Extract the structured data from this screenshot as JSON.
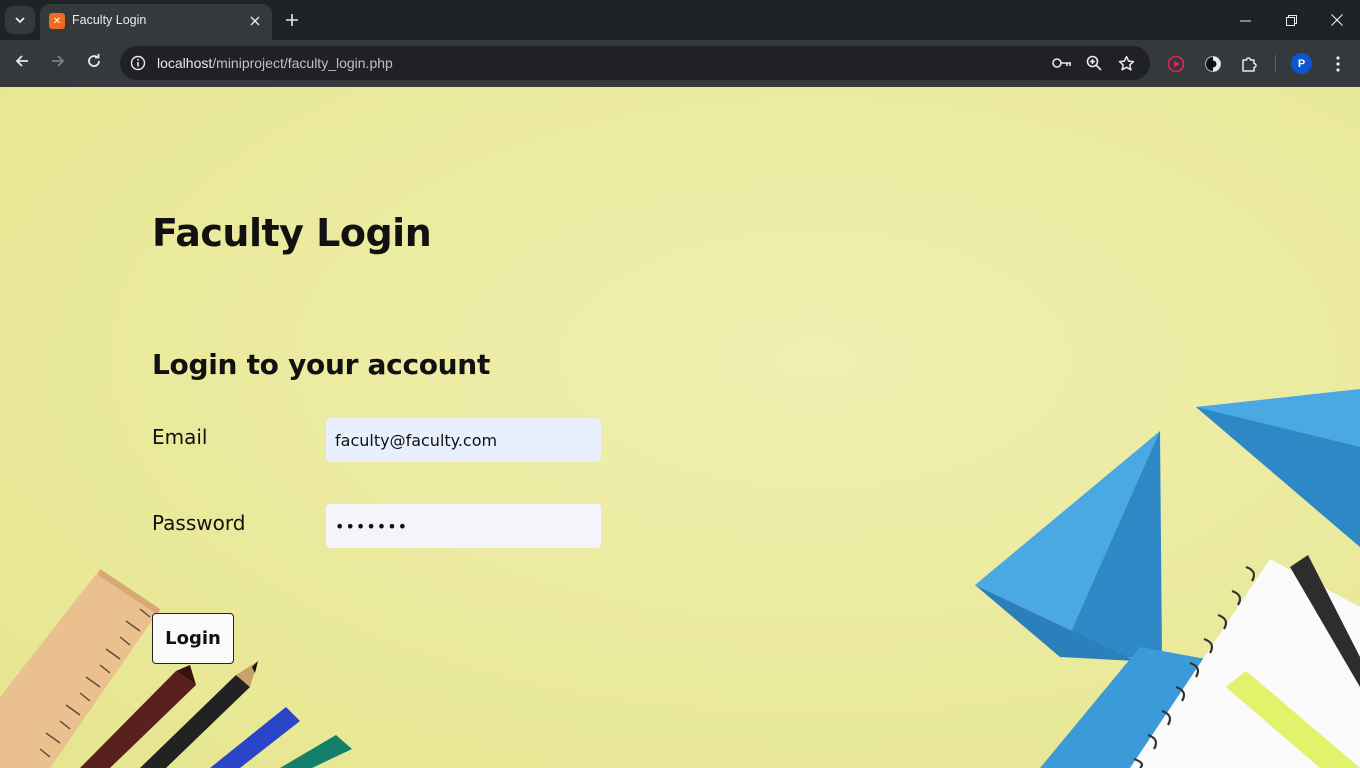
{
  "browser": {
    "tab_title": "Faculty Login",
    "url_host": "localhost",
    "url_path": "/miniproject/faculty_login.php",
    "profile_initial": "P"
  },
  "page": {
    "title": "Faculty Login",
    "subtitle": "Login to your account",
    "email_label": "Email",
    "email_value": "faculty@faculty.com",
    "password_label": "Password",
    "password_value": "•••••••",
    "login_button": "Login"
  },
  "colors": {
    "page_background": "#ecec9e",
    "paper_plane": "#3a9bd8",
    "email_field": "#e8f0fe"
  },
  "icons": [
    "chevron-down-icon",
    "xampp-favicon-icon",
    "close-icon",
    "plus-icon",
    "minimize-icon",
    "restore-icon",
    "back-icon",
    "forward-icon",
    "reload-icon",
    "info-icon",
    "key-icon",
    "zoom-icon",
    "star-icon",
    "record-icon",
    "extension-dark-icon",
    "puzzle-icon",
    "more-vert-icon"
  ]
}
